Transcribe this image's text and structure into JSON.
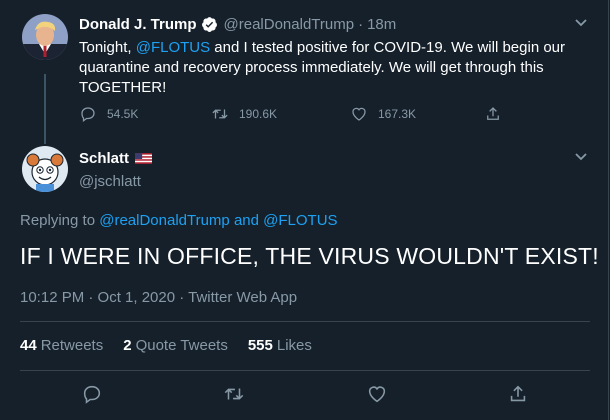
{
  "colors": {
    "background": "#15202b",
    "accent": "#1da1f2",
    "secondary_text": "#8899a6",
    "divider": "#38444d"
  },
  "original_tweet": {
    "name": "Donald J. Trump",
    "verified_icon": "verified-badge-icon",
    "handle": "@realDonaldTrump",
    "separator": "·",
    "time": "18m",
    "text_pre": "Tonight, ",
    "mention": "@FLOTUS",
    "text_post": " and I tested positive for COVID-19. We will begin our quarantine and recovery process immediately. We will get through this TOGETHER!",
    "replies": "54.5K",
    "retweets": "190.6K",
    "likes": "167.3K"
  },
  "reply_tweet": {
    "name": "Schlatt",
    "flag_icon": "us-flag-icon",
    "handle": "@jschlatt",
    "replying_label": "Replying to",
    "replying_mention_1": "@realDonaldTrump",
    "replying_and": "and",
    "replying_mention_2": "@FLOTUS",
    "text": "IF I WERE IN OFFICE, THE VIRUS WOULDN'T EXIST!",
    "timestamp": "10:12 PM · Oct 1, 2020 · Twitter Web App",
    "retweet_count": "44",
    "retweet_label": "Retweets",
    "quote_count": "2",
    "quote_label": "Quote Tweets",
    "like_count": "555",
    "like_label": "Likes"
  }
}
